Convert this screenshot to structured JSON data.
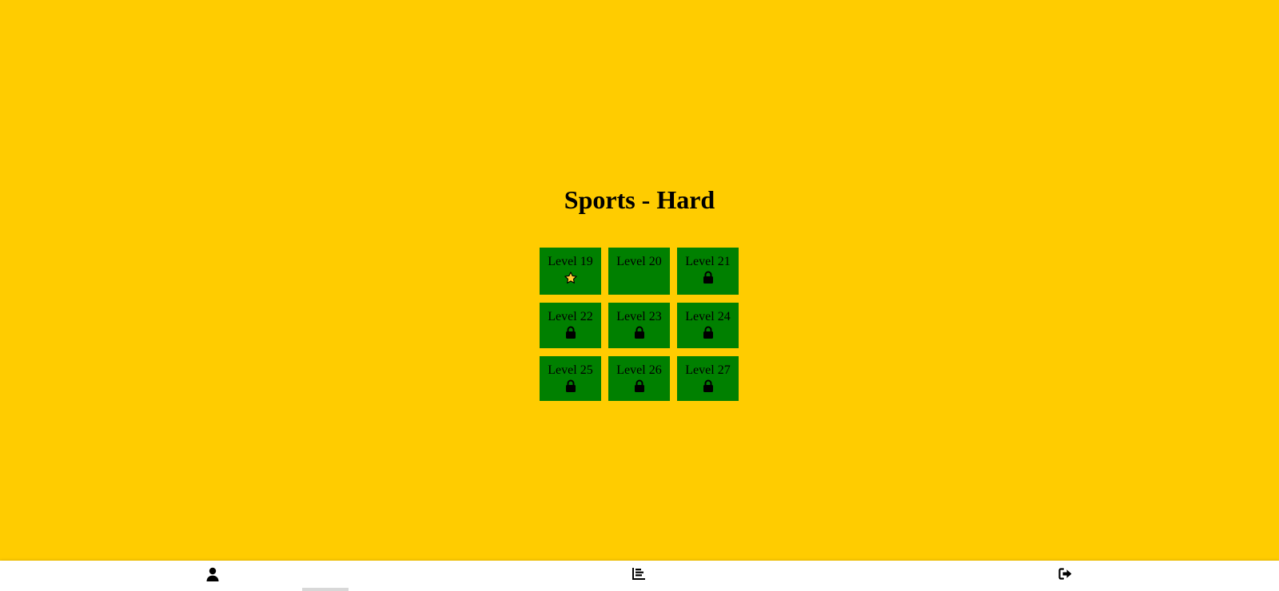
{
  "page": {
    "title": "Sports - Hard",
    "background": "#ffcc00",
    "tile_color": "#008000"
  },
  "levels": [
    {
      "label": "Level 19",
      "status": "star",
      "icon": "star-icon"
    },
    {
      "label": "Level 20",
      "status": "unlocked",
      "icon": ""
    },
    {
      "label": "Level 21",
      "status": "locked",
      "icon": "lock-icon"
    },
    {
      "label": "Level 22",
      "status": "locked",
      "icon": "lock-icon"
    },
    {
      "label": "Level 23",
      "status": "locked",
      "icon": "lock-icon"
    },
    {
      "label": "Level 24",
      "status": "locked",
      "icon": "lock-icon"
    },
    {
      "label": "Level 25",
      "status": "locked",
      "icon": "lock-icon"
    },
    {
      "label": "Level 26",
      "status": "locked",
      "icon": "lock-icon"
    },
    {
      "label": "Level 27",
      "status": "locked",
      "icon": "lock-icon"
    }
  ],
  "footer": {
    "items": [
      {
        "name": "profile",
        "icon": "user-icon"
      },
      {
        "name": "stats",
        "icon": "bar-chart-icon"
      },
      {
        "name": "logout",
        "icon": "logout-icon"
      }
    ]
  }
}
